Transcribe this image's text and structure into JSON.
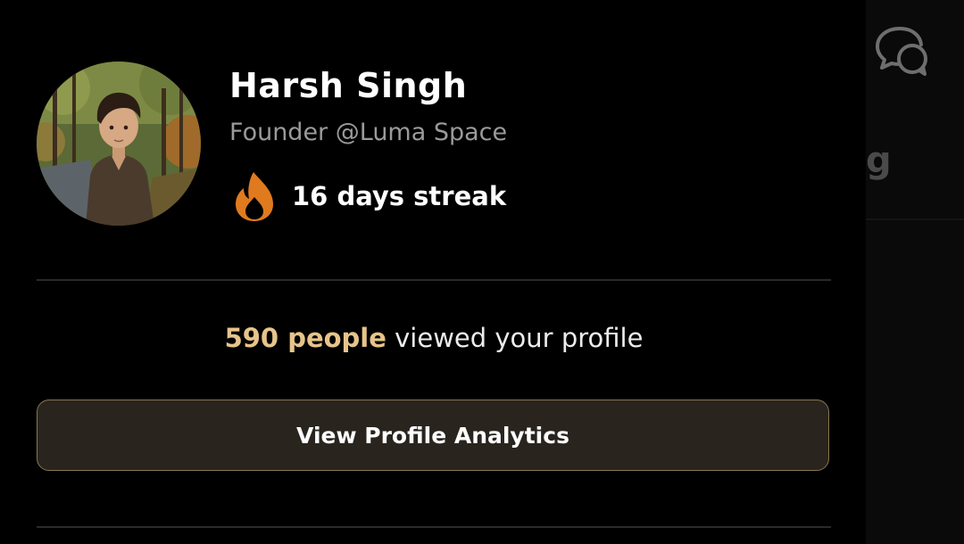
{
  "profile": {
    "name": "Harsh Singh",
    "subtitle": "Founder @Luma Space",
    "streak_text": "16 days streak",
    "avatar_icon": "user-avatar-illustration"
  },
  "views": {
    "highlight": "590 people",
    "rest": " viewed your profile"
  },
  "actions": {
    "analytics_label": "View Profile Analytics"
  },
  "background_panel": {
    "partial_letter": "g",
    "icon": "chat-bubbles-icon"
  },
  "colors": {
    "accent": "#e6c48a",
    "flame": "#e07a1f",
    "button_bg": "#29241e",
    "button_border": "#8a7652",
    "subtitle": "#9a9a9a"
  }
}
